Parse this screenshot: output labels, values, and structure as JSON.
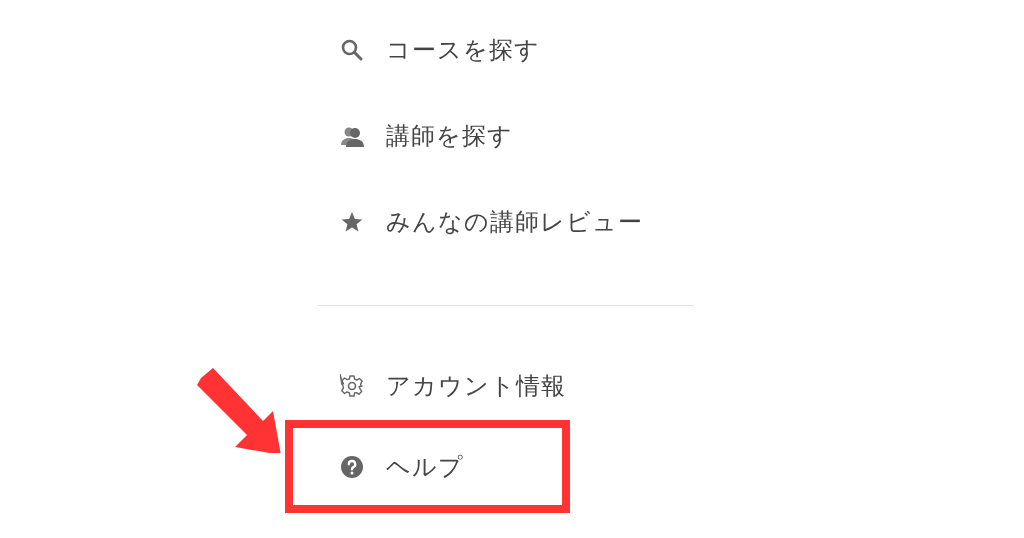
{
  "sections": [
    {
      "items": [
        {
          "kind": "search",
          "label": "コースを探す",
          "highlighted": false
        },
        {
          "kind": "people",
          "label": "講師を探す",
          "highlighted": false
        },
        {
          "kind": "star",
          "label": "みんなの講師レビュー",
          "highlighted": false
        }
      ]
    },
    {
      "items": [
        {
          "kind": "gear",
          "label": "アカウント情報",
          "highlighted": false
        },
        {
          "kind": "help",
          "label": "ヘルプ",
          "highlighted": true
        }
      ]
    }
  ]
}
